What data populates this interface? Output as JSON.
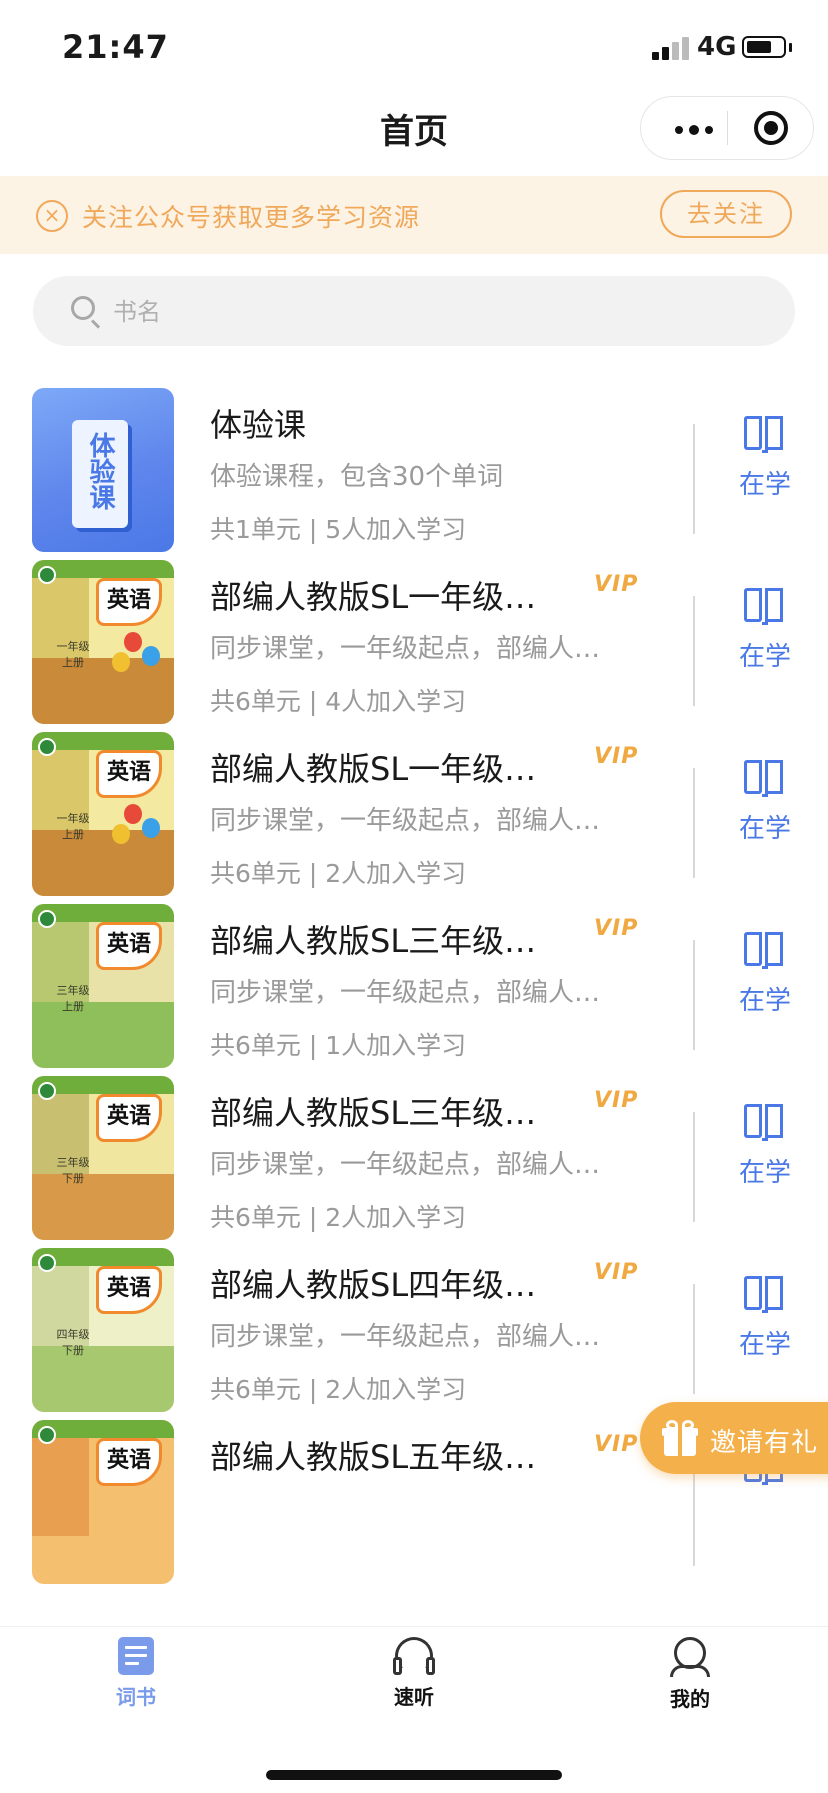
{
  "status_bar": {
    "time": "21:47",
    "network": "4G",
    "icons": [
      "signal-icon",
      "battery-icon"
    ]
  },
  "nav": {
    "title": "首页",
    "capsule_icons": [
      "more-dots-icon",
      "close-target-icon"
    ]
  },
  "banner": {
    "text": "关注公众号获取更多学习资源",
    "button": "去关注",
    "color": "#f0a85a",
    "background": "#fdf3e4"
  },
  "search": {
    "placeholder": "书名",
    "value": ""
  },
  "books": [
    {
      "title": "体验课",
      "vip": "",
      "desc": "体验课程，包含30个单词",
      "meta": "共1单元 | 5人加入学习",
      "action": "在学",
      "cover_text": "体验课",
      "cover_type": "trial"
    },
    {
      "title": "部编人教版SL一年级…",
      "vip": "VIP",
      "desc": "同步课堂，一年级起点，部编人…",
      "meta": "共6单元 | 4人加入学习",
      "action": "在学",
      "cover_text": "英语",
      "cover_grade": "一年级",
      "cover_vol": "上册"
    },
    {
      "title": "部编人教版SL一年级…",
      "vip": "VIP",
      "desc": "同步课堂，一年级起点，部编人…",
      "meta": "共6单元 | 2人加入学习",
      "action": "在学",
      "cover_text": "英语",
      "cover_grade": "一年级",
      "cover_vol": "上册"
    },
    {
      "title": "部编人教版SL三年级…",
      "vip": "VIP",
      "desc": "同步课堂，一年级起点，部编人…",
      "meta": "共6单元 | 1人加入学习",
      "action": "在学",
      "cover_text": "英语",
      "cover_grade": "三年级",
      "cover_vol": "上册"
    },
    {
      "title": "部编人教版SL三年级…",
      "vip": "VIP",
      "desc": "同步课堂，一年级起点，部编人…",
      "meta": "共6单元 | 2人加入学习",
      "action": "在学",
      "cover_text": "英语",
      "cover_grade": "三年级",
      "cover_vol": "下册"
    },
    {
      "title": "部编人教版SL四年级…",
      "vip": "VIP",
      "desc": "同步课堂，一年级起点，部编人…",
      "meta": "共6单元 | 2人加入学习",
      "action": "在学",
      "cover_text": "英语",
      "cover_grade": "四年级",
      "cover_vol": "下册"
    },
    {
      "title": "部编人教版SL五年级…",
      "vip": "VIP",
      "desc": "",
      "meta": "",
      "action": "",
      "cover_text": "英语",
      "cover_grade": "",
      "cover_vol": ""
    }
  ],
  "invite": {
    "label": "邀请有礼",
    "icon": "gift-icon",
    "color": "#f4b04a"
  },
  "tabbar": {
    "tabs": [
      {
        "label": "词书",
        "icon": "wordbook-icon",
        "active": true
      },
      {
        "label": "速听",
        "icon": "headphones-icon",
        "active": false
      },
      {
        "label": "我的",
        "icon": "profile-icon",
        "active": false
      }
    ],
    "active_color": "#7a9bea"
  },
  "accent_color": "#4a78e6",
  "vip_color": "#f0a840"
}
